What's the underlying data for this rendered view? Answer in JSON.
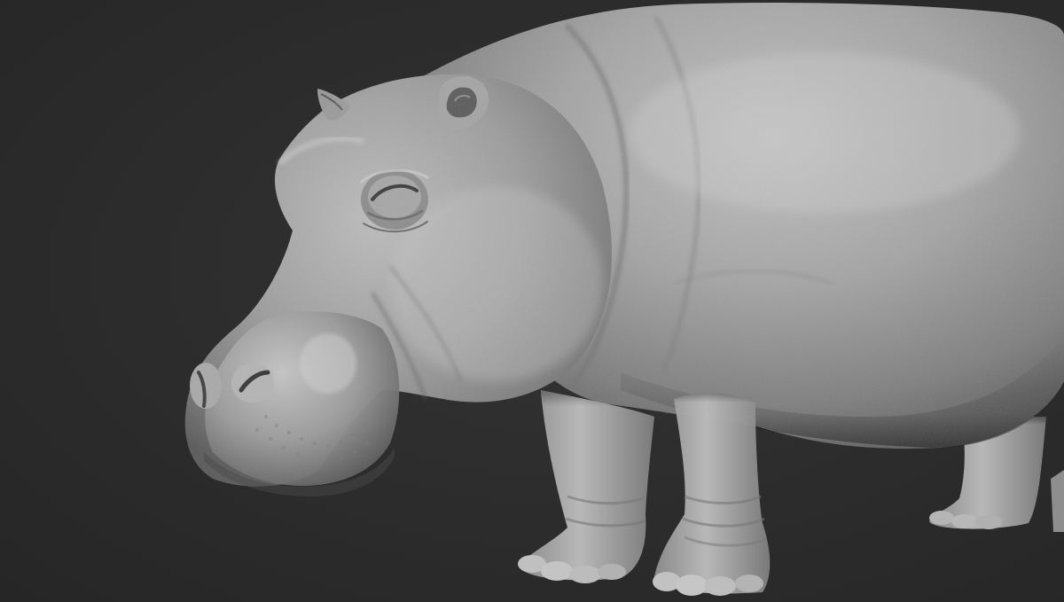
{
  "scene": {
    "subject": "hippopotamus-sculpt",
    "background_color": "#2b2b2b",
    "material_color": "#9a9a9a"
  }
}
